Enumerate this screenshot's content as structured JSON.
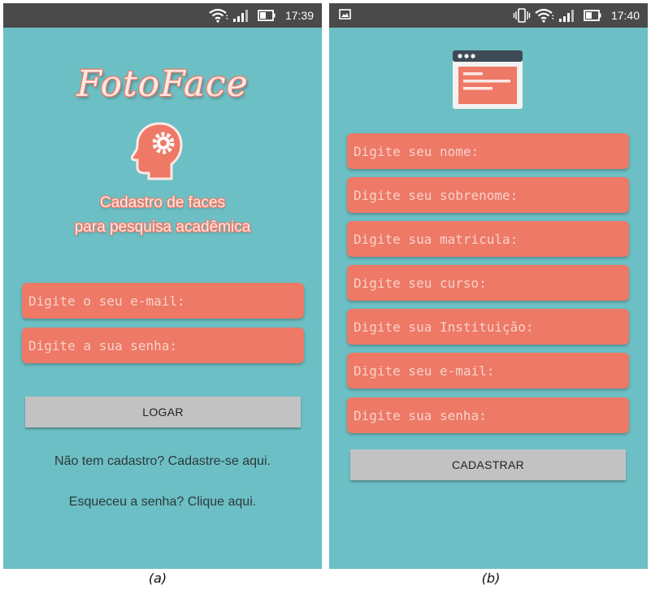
{
  "colors": {
    "background": "#6cbfc4",
    "statusbar": "#4a4a4a",
    "field": "#ed7966",
    "field_text": "#f8d2cb",
    "button": "#c2c2c2",
    "accent": "#ed7966"
  },
  "screen_a": {
    "status": {
      "time": "17:39",
      "icons": [
        "wifi-icon",
        "signal-icon",
        "battery-icon"
      ]
    },
    "app_title": "FotoFace",
    "logo_icon": "head-gear-icon",
    "tagline_line1": "Cadastro de faces",
    "tagline_line2": "para pesquisa acadêmica",
    "email_placeholder": "Digite o seu e-mail:",
    "password_placeholder": "Digite a sua senha:",
    "login_button": "LOGAR",
    "register_link": "Não tem cadastro? Cadastre-se aqui.",
    "forgot_link": "Esqueceu a senha? Clique aqui.",
    "caption": "(a)"
  },
  "screen_b": {
    "status": {
      "time": "17:40",
      "icons": [
        "image-notification-icon",
        "vibrate-icon",
        "wifi-icon",
        "signal-icon",
        "battery-icon"
      ]
    },
    "header_icon": "browser-window-icon",
    "fields": [
      "Digite seu nome:",
      "Digite seu sobrenome:",
      "Digite sua matricula:",
      "Digite seu curso:",
      "Digite sua Instituição:",
      "Digite seu e-mail:",
      "Digite sua senha:"
    ],
    "register_button": "CADASTRAR",
    "caption": "(b)"
  }
}
